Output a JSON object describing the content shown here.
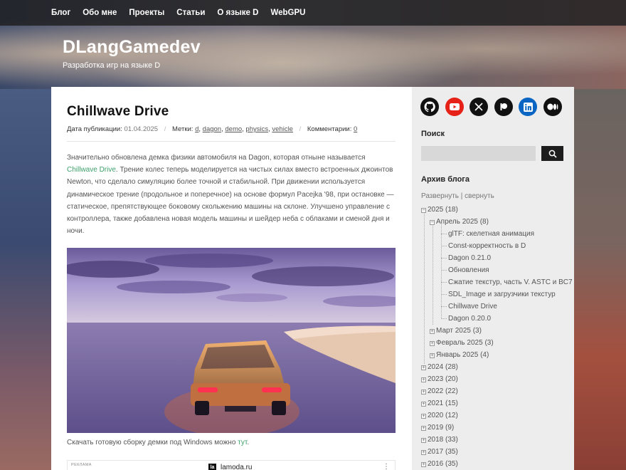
{
  "nav": [
    "Блог",
    "Обо мне",
    "Проекты",
    "Статьи",
    "О языке D",
    "WebGPU"
  ],
  "site": {
    "title": "DLangGamedev",
    "description": "Разработка игр на языке D"
  },
  "post": {
    "title": "Chillwave Drive",
    "date_label": "Дата публикации:",
    "date": "01.04.2025",
    "tags_label": "Метки:",
    "tags": [
      "d",
      "dagon",
      "demo",
      "physics",
      "vehicle"
    ],
    "comments_label": "Комментарии:",
    "comments": "0",
    "body_before": "Значительно обновлена демка физики автомобиля на Dagon, которая отныне называется ",
    "body_link": "Chillwave Drive",
    "body_after": ". Трение колес теперь моделируется на чистых силах вместо встроенных джоинтов Newton, что сделало симуляцию более точной и стабильной. При движении используется динамическое трение (продольное и поперечное) на основе формул Pacejka '98, при остановке — статическое, препятствующее боковому скольжению машины на склоне. Улучшено управление с контроллера, также добавлена новая модель машины и шейдер неба с облаками и сменой дня и ночи.",
    "download_text": "Скачать готовую сборку демки под Windows можно ",
    "download_link": "тут",
    "download_end": "."
  },
  "ad": {
    "label": "РЕКЛАМА",
    "site": "lamoda.ru",
    "logo": "la",
    "menu": "⋮"
  },
  "sidebar": {
    "socials": [
      "github-icon",
      "youtube-icon",
      "x-icon",
      "patreon-icon",
      "linkedin-icon",
      "medium-icon"
    ],
    "search_heading": "Поиск",
    "search_placeholder": "",
    "archive_heading": "Архив блога",
    "archive_controls": "Развернуть | свернуть",
    "archive": {
      "year_2025": "2025 (18)",
      "april": "Апрель 2025 (8)",
      "april_posts": [
        "glTF: скелетная анимация",
        "Const-корректность в D",
        "Dagon 0.21.0",
        "Обновления",
        "Сжатие текстур, часть V. ASTC и BC7",
        "SDL_Image и загрузчики текстур",
        "Chillwave Drive",
        "Dagon 0.20.0"
      ],
      "months": [
        "Март 2025 (3)",
        "Февраль 2025 (3)",
        "Январь 2025 (4)"
      ],
      "years": [
        "2024 (28)",
        "2023 (20)",
        "2022 (22)",
        "2021 (15)",
        "2020 (12)",
        "2019 (9)",
        "2018 (33)",
        "2017 (35)",
        "2016 (35)"
      ]
    }
  },
  "colors": {
    "accent": "#3ea06b",
    "nav_bg": "#1e1e20",
    "youtube": "#e62117",
    "linkedin": "#0a66c2"
  }
}
